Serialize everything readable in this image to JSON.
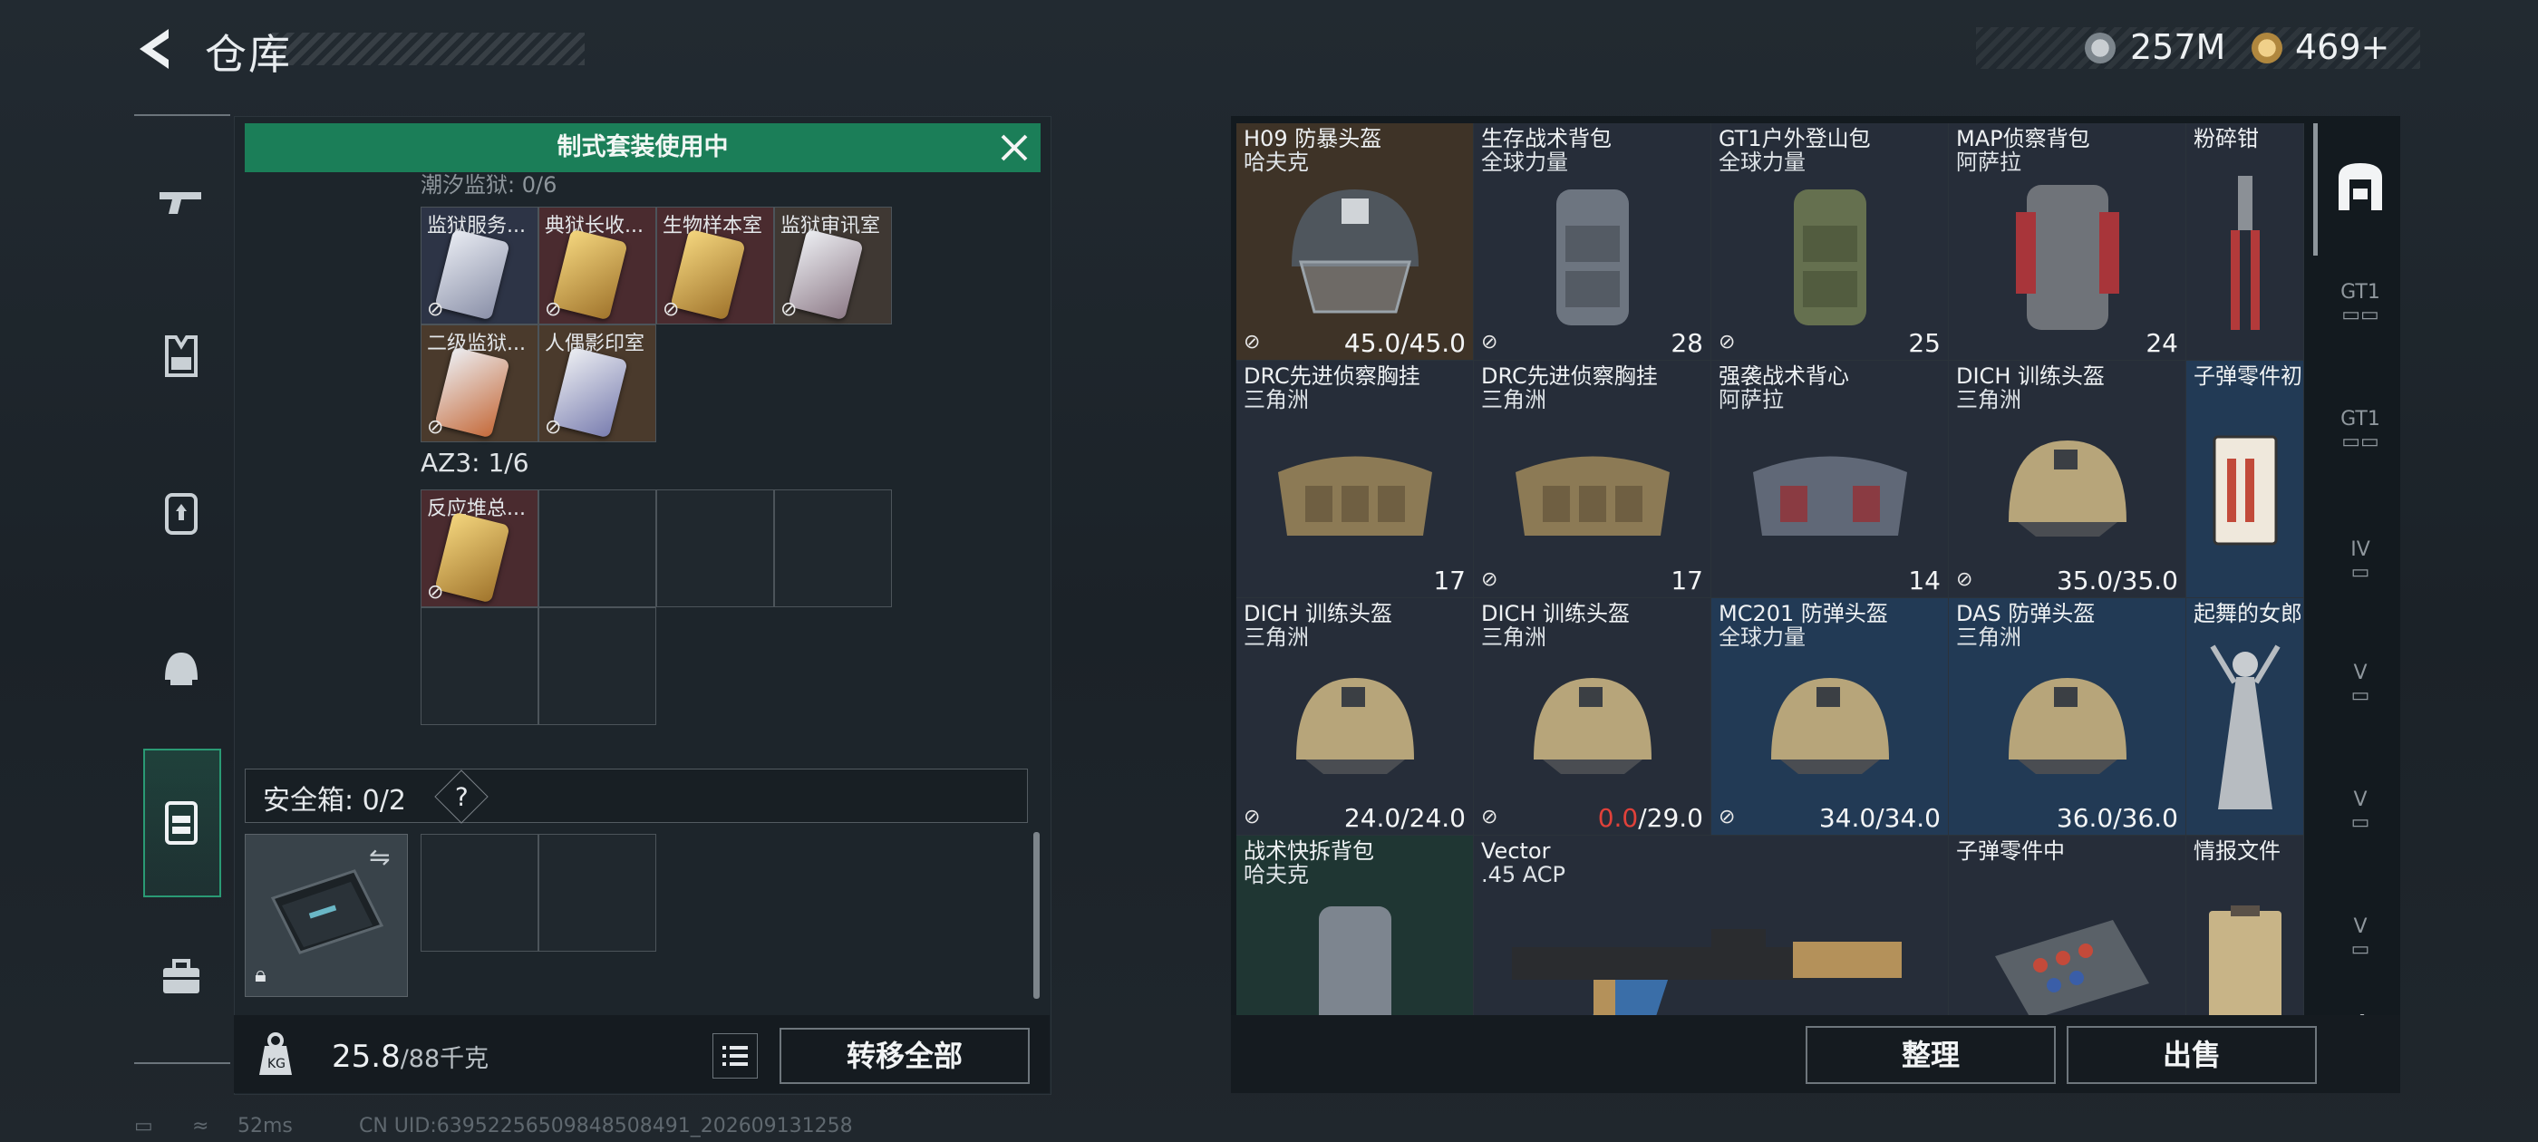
{
  "header": {
    "title": "仓库",
    "back_icon": "back-arrow-icon"
  },
  "currency": [
    {
      "icon": "silver-coin-icon",
      "value": "257M"
    },
    {
      "icon": "gold-coin-icon",
      "value": "469+"
    }
  ],
  "nav": {
    "items": [
      {
        "name": "weapons",
        "icon": "gun-icon"
      },
      {
        "name": "armor",
        "icon": "vest-icon"
      },
      {
        "name": "backpack",
        "icon": "backpack-icon"
      },
      {
        "name": "helmet",
        "icon": "helmet-icon"
      },
      {
        "name": "container",
        "icon": "container-icon",
        "active": true
      },
      {
        "name": "toolbox",
        "icon": "toolbox-icon"
      }
    ]
  },
  "left": {
    "banner": "制式套装使用中",
    "section_cut": "潮汐监狱: 0/6",
    "keys_row1": [
      "监狱服务...",
      "典狱长收...",
      "生物样本室",
      "监狱审讯室"
    ],
    "keys_row2": [
      "二级监狱...",
      "人偶影印室"
    ],
    "az3_label": "AZ3: 1/6",
    "az3_items": [
      "反应堆总..."
    ],
    "safe_label": "安全箱: 0/2",
    "safe_help": "?",
    "weight_value": "25.8",
    "weight_cap": "/88千克",
    "transfer_btn": "转移全部"
  },
  "right": {
    "items": [
      {
        "name": "H09 防暴头盔",
        "sub": "哈夫克",
        "value": "45.0/45.0",
        "lock": true,
        "bg": "#3e3327"
      },
      {
        "name": "生存战术背包",
        "sub": "全球力量",
        "value": "28",
        "lock": true,
        "bg": "#262d39"
      },
      {
        "name": "GT1户外登山包",
        "sub": "全球力量",
        "value": "25",
        "lock": true,
        "bg": "#262d39"
      },
      {
        "name": "MAP侦察背包",
        "sub": "阿萨拉",
        "value": "24",
        "lock": false,
        "bg": "#262d39"
      },
      {
        "name": "粉碎钳",
        "sub": "",
        "value": "",
        "lock": false,
        "bg": "#262d39"
      },
      {
        "name": "DRC先进侦察胸挂",
        "sub": "三角洲",
        "value": "17",
        "lock": false,
        "bg": "#262d39"
      },
      {
        "name": "DRC先进侦察胸挂",
        "sub": "三角洲",
        "value": "17",
        "lock": true,
        "bg": "#262d39"
      },
      {
        "name": "强袭战术背心",
        "sub": "阿萨拉",
        "value": "14",
        "lock": false,
        "bg": "#262d39"
      },
      {
        "name": "DICH 训练头盔",
        "sub": "三角洲",
        "value": "35.0/35.0",
        "lock": true,
        "bg": "#262d39"
      },
      {
        "name": "子弹零件初",
        "sub": "",
        "value": "",
        "lock": false,
        "bg": "#223a55"
      },
      {
        "name": "DICH 训练头盔",
        "sub": "三角洲",
        "value": "24.0/24.0",
        "lock": true,
        "bg": "#262d39"
      },
      {
        "name": "DICH 训练头盔",
        "sub": "三角洲",
        "value_red": "0.0",
        "value": "/29.0",
        "lock": true,
        "bg": "#262d39"
      },
      {
        "name": "MC201 防弹头盔",
        "sub": "全球力量",
        "value": "34.0/34.0",
        "lock": true,
        "bg": "#223a55"
      },
      {
        "name": "DAS 防弹头盔",
        "sub": "三角洲",
        "value": "36.0/36.0",
        "lock": false,
        "bg": "#223a55"
      },
      {
        "name": "起舞的女郎",
        "sub": "",
        "value": "",
        "lock": false,
        "bg": "#223a55"
      },
      {
        "name": "战术快拆背包",
        "sub": "哈夫克",
        "value": "",
        "lock": false,
        "bg": "#1f3633"
      },
      {
        "name": "Vector",
        "sub": ".45 ACP",
        "value": "",
        "lock": false,
        "bg": "#262d39"
      },
      {
        "name": "子弹零件中",
        "sub": "",
        "value": "",
        "lock": false,
        "bg": "#262d39"
      },
      {
        "name": "情报文件",
        "sub": "",
        "value": "",
        "lock": false,
        "bg": "#262d39"
      }
    ],
    "organize_btn": "整理",
    "sell_btn": "出售"
  },
  "status": {
    "ping": "52ms",
    "uid": "CN UID:63952256509848508491_202609131258"
  }
}
